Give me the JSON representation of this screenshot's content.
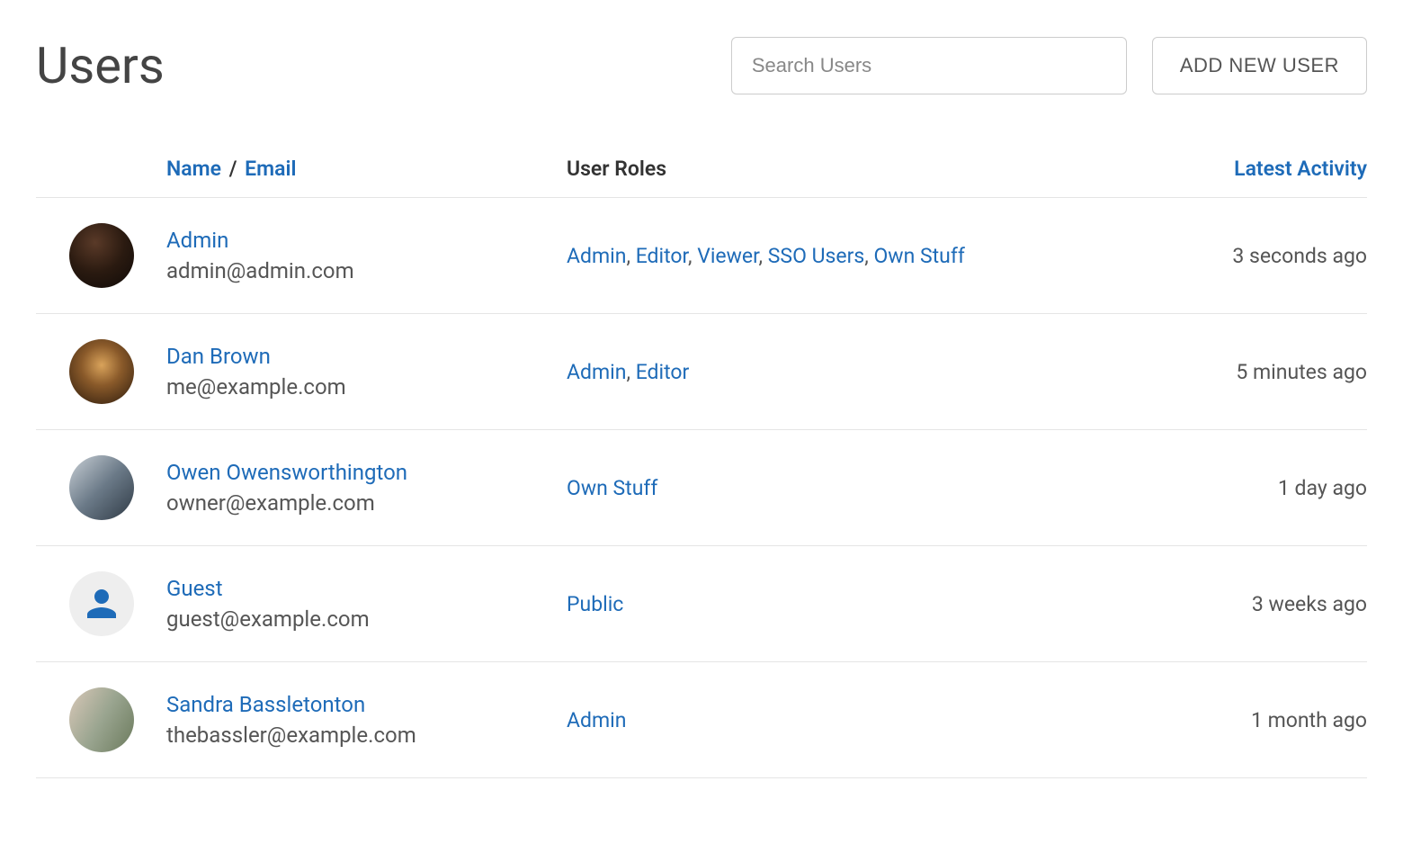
{
  "header": {
    "title": "Users",
    "search_placeholder": "Search Users",
    "add_user_label": "ADD NEW USER"
  },
  "table": {
    "columns": {
      "name": "Name",
      "email": "Email",
      "roles": "User Roles",
      "activity": "Latest Activity"
    }
  },
  "users": [
    {
      "name": "Admin",
      "email": "admin@admin.com",
      "roles": [
        "Admin",
        "Editor",
        "Viewer",
        "SSO Users",
        "Own Stuff"
      ],
      "activity": "3 seconds ago",
      "avatar_class": "photo-1",
      "avatar_type": "photo"
    },
    {
      "name": "Dan Brown",
      "email": "me@example.com",
      "roles": [
        "Admin",
        "Editor"
      ],
      "activity": "5 minutes ago",
      "avatar_class": "photo-2",
      "avatar_type": "photo"
    },
    {
      "name": "Owen Owensworthington",
      "email": "owner@example.com",
      "roles": [
        "Own Stuff"
      ],
      "activity": "1 day ago",
      "avatar_class": "photo-3",
      "avatar_type": "photo"
    },
    {
      "name": "Guest",
      "email": "guest@example.com",
      "roles": [
        "Public"
      ],
      "activity": "3 weeks ago",
      "avatar_class": "photo-4",
      "avatar_type": "icon"
    },
    {
      "name": "Sandra Bassletonton",
      "email": "thebassler@example.com",
      "roles": [
        "Admin"
      ],
      "activity": "1 month ago",
      "avatar_class": "photo-5",
      "avatar_type": "photo"
    }
  ]
}
